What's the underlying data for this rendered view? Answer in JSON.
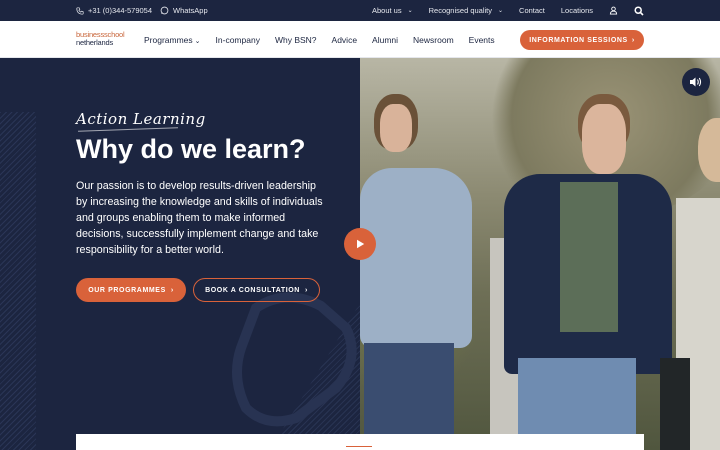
{
  "topbar": {
    "phone": "+31 (0)344-579054",
    "whatsapp": "WhatsApp",
    "links": [
      "About us",
      "Recognised quality",
      "Contact",
      "Locations"
    ]
  },
  "logo": {
    "line1": "businessschool",
    "line2": "netherlands"
  },
  "nav": {
    "items": [
      "Programmes",
      "In-company",
      "Why BSN?",
      "Advice",
      "Alumni",
      "Newsroom",
      "Events"
    ],
    "cta": "INFORMATION SESSIONS"
  },
  "hero": {
    "script": "Action Learning",
    "title": "Why do we learn?",
    "text": "Our passion is to develop results-driven leadership by increasing the knowledge and skills of individuals and groups enabling them to make informed decisions, successfully implement change and take responsibility for a better world.",
    "primary_button": "OUR PROGRAMMES",
    "secondary_button": "BOOK A CONSULTATION"
  },
  "colors": {
    "navy": "#1c2540",
    "accent": "#d9623a",
    "white": "#ffffff"
  },
  "icons": [
    "phone-icon",
    "whatsapp-icon",
    "user-icon",
    "search-icon",
    "play-icon",
    "sound-icon",
    "chevron-right-icon",
    "chevron-down-icon"
  ]
}
